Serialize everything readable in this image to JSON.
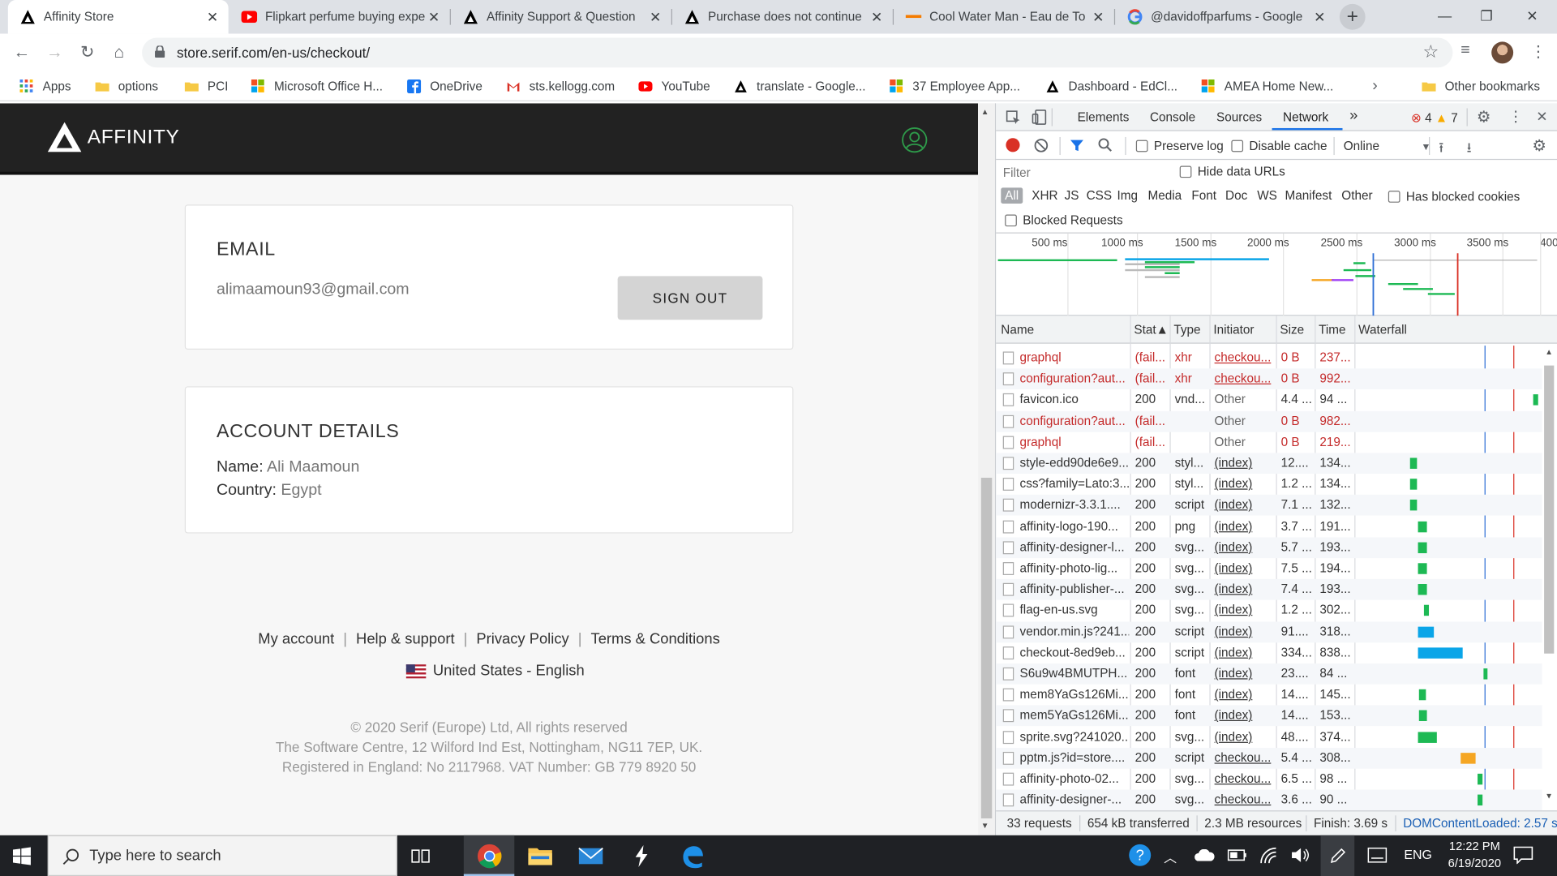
{
  "browser": {
    "tabs": [
      {
        "title": "Affinity Store",
        "icon": "affinity-icon",
        "active": true
      },
      {
        "title": "Flipkart perfume buying expe",
        "icon": "youtube-icon",
        "active": false
      },
      {
        "title": "Affinity Support & Question",
        "icon": "affinity-icon",
        "active": false
      },
      {
        "title": "Purchase does not continue",
        "icon": "affinity-icon",
        "active": false
      },
      {
        "title": "Cool Water Man - Eau de To",
        "icon": "dash-icon",
        "active": false
      },
      {
        "title": "@davidoffparfums - Google",
        "icon": "google-icon",
        "active": false
      }
    ],
    "url": "store.serif.com/en-us/checkout/",
    "bookmarks": [
      {
        "label": "Apps",
        "icon": "apps-grid-icon"
      },
      {
        "label": "options",
        "icon": "folder-icon"
      },
      {
        "label": "PCI",
        "icon": "folder-icon"
      },
      {
        "label": "Microsoft Office H...",
        "icon": "microsoft-icon"
      },
      {
        "label": "OneDrive",
        "icon": "facebook-icon"
      },
      {
        "label": "sts.kellogg.com",
        "icon": "gmail-icon"
      },
      {
        "label": "YouTube",
        "icon": "youtube-icon"
      },
      {
        "label": "translate - Google...",
        "icon": "affinity-icon"
      },
      {
        "label": "37 Employee App...",
        "icon": "microsoft-icon"
      },
      {
        "label": "Dashboard - EdCl...",
        "icon": "affinity-icon"
      },
      {
        "label": "AMEA Home New...",
        "icon": "microsoft-icon"
      }
    ],
    "other_bookmarks": "Other bookmarks"
  },
  "site": {
    "logo_text": "AFFINITY",
    "email_card": {
      "heading": "EMAIL",
      "email": "alimaamoun93@gmail.com",
      "signout_label": "SIGN OUT"
    },
    "account_card": {
      "heading": "ACCOUNT DETAILS",
      "name_label": "Name:",
      "name_value": "Ali Maamoun",
      "country_label": "Country:",
      "country_value": "Egypt"
    },
    "footer": {
      "links": [
        "My account",
        "Help & support",
        "Privacy Policy",
        "Terms & Conditions"
      ],
      "locale": "United States - English",
      "copyright": "© 2020 Serif (Europe) Ltd, All rights reserved",
      "address": "The Software Centre, 12 Wilford Ind Est, Nottingham, NG11 7EP, UK.",
      "registration": "Registered in England: No 2117968. VAT Number: GB 779 8920 50"
    }
  },
  "devtools": {
    "tabs": [
      "Elements",
      "Console",
      "Sources",
      "Network"
    ],
    "more": "»",
    "errors": "4",
    "warnings": "7",
    "preserve_log": "Preserve log",
    "disable_cache": "Disable cache",
    "throttle": "Online",
    "filter_placeholder": "Filter",
    "hide_data_urls": "Hide data URLs",
    "type_filters": [
      "All",
      "XHR",
      "JS",
      "CSS",
      "Img",
      "Media",
      "Font",
      "Doc",
      "WS",
      "Manifest",
      "Other"
    ],
    "has_blocked_cookies": "Has blocked cookies",
    "blocked_requests": "Blocked Requests",
    "timeline_ticks": [
      "500 ms",
      "1000 ms",
      "1500 ms",
      "2000 ms",
      "2500 ms",
      "3000 ms",
      "3500 ms",
      "400"
    ],
    "columns": [
      "Name",
      "Status",
      "Type",
      "Initiator",
      "Size",
      "Time",
      "Waterfall"
    ],
    "status_col_label": "Stat▲",
    "rows": [
      {
        "name": "graphql",
        "status": "(fail...",
        "type": "xhr",
        "initiator": "checkou...",
        "size": "0 B",
        "time": "237...",
        "fail": true,
        "wf_start": null,
        "wf_width": null,
        "wf_color": ""
      },
      {
        "name": "configuration?aut...",
        "status": "(fail...",
        "type": "xhr",
        "initiator": "checkou...",
        "size": "0 B",
        "time": "992...",
        "fail": true,
        "wf_start": null,
        "wf_width": null,
        "wf_color": ""
      },
      {
        "name": "favicon.ico",
        "status": "200",
        "type": "vnd...",
        "initiator": "Other",
        "size": "4.4 ...",
        "time": "94 ...",
        "fail": false,
        "wf_start": 3560,
        "wf_width": 100,
        "wf_color": "#1db954"
      },
      {
        "name": "configuration?aut...",
        "status": "(fail...",
        "type": "",
        "initiator": "Other",
        "size": "0 B",
        "time": "982...",
        "fail": true,
        "wf_start": null,
        "wf_width": null,
        "wf_color": ""
      },
      {
        "name": "graphql",
        "status": "(fail...",
        "type": "",
        "initiator": "Other",
        "size": "0 B",
        "time": "219...",
        "fail": true,
        "wf_start": null,
        "wf_width": null,
        "wf_color": ""
      },
      {
        "name": "style-edd90de6e9...",
        "status": "200",
        "type": "styl...",
        "initiator": "(index)",
        "size": "12....",
        "time": "134...",
        "fail": false,
        "wf_start": 1100,
        "wf_width": 130,
        "wf_color": "#1db954"
      },
      {
        "name": "css?family=Lato:3...",
        "status": "200",
        "type": "styl...",
        "initiator": "(index)",
        "size": "1.2 ...",
        "time": "134...",
        "fail": false,
        "wf_start": 1100,
        "wf_width": 130,
        "wf_color": "#1db954"
      },
      {
        "name": "modernizr-3.3.1....",
        "status": "200",
        "type": "script",
        "initiator": "(index)",
        "size": "7.1 ...",
        "time": "132...",
        "fail": false,
        "wf_start": 1100,
        "wf_width": 130,
        "wf_color": "#1db954"
      },
      {
        "name": "affinity-logo-190...",
        "status": "200",
        "type": "png",
        "initiator": "(index)",
        "size": "3.7 ...",
        "time": "191...",
        "fail": false,
        "wf_start": 1250,
        "wf_width": 190,
        "wf_color": "#1db954"
      },
      {
        "name": "affinity-designer-l...",
        "status": "200",
        "type": "svg...",
        "initiator": "(index)",
        "size": "5.7 ...",
        "time": "193...",
        "fail": false,
        "wf_start": 1250,
        "wf_width": 190,
        "wf_color": "#1db954"
      },
      {
        "name": "affinity-photo-lig...",
        "status": "200",
        "type": "svg...",
        "initiator": "(index)",
        "size": "7.5 ...",
        "time": "194...",
        "fail": false,
        "wf_start": 1250,
        "wf_width": 190,
        "wf_color": "#1db954"
      },
      {
        "name": "affinity-publisher-...",
        "status": "200",
        "type": "svg...",
        "initiator": "(index)",
        "size": "7.4 ...",
        "time": "193...",
        "fail": false,
        "wf_start": 1250,
        "wf_width": 190,
        "wf_color": "#1db954"
      },
      {
        "name": "flag-en-us.svg",
        "status": "200",
        "type": "svg...",
        "initiator": "(index)",
        "size": "1.2 ...",
        "time": "302...",
        "fail": false,
        "wf_start": 1370,
        "wf_width": 110,
        "wf_color": "#1db954"
      },
      {
        "name": "vendor.min.js?241...",
        "status": "200",
        "type": "script",
        "initiator": "(index)",
        "size": "91....",
        "time": "318...",
        "fail": false,
        "wf_start": 1250,
        "wf_width": 330,
        "wf_color": "#0aa5e8"
      },
      {
        "name": "checkout-8ed9eb...",
        "status": "200",
        "type": "script",
        "initiator": "(index)",
        "size": "334...",
        "time": "838...",
        "fail": false,
        "wf_start": 1250,
        "wf_width": 900,
        "wf_color": "#0aa5e8"
      },
      {
        "name": "S6u9w4BMUTPH...",
        "status": "200",
        "type": "font",
        "initiator": "(index)",
        "size": "23....",
        "time": "84 ...",
        "fail": false,
        "wf_start": 2560,
        "wf_width": 70,
        "wf_color": "#1db954"
      },
      {
        "name": "mem8YaGs126Mi...",
        "status": "200",
        "type": "font",
        "initiator": "(index)",
        "size": "14....",
        "time": "145...",
        "fail": false,
        "wf_start": 1280,
        "wf_width": 140,
        "wf_color": "#1db954"
      },
      {
        "name": "mem5YaGs126Mi...",
        "status": "200",
        "type": "font",
        "initiator": "(index)",
        "size": "14....",
        "time": "153...",
        "fail": false,
        "wf_start": 1280,
        "wf_width": 150,
        "wf_color": "#1db954"
      },
      {
        "name": "sprite.svg?241020...",
        "status": "200",
        "type": "svg...",
        "initiator": "(index)",
        "size": "48....",
        "time": "374...",
        "fail": false,
        "wf_start": 1260,
        "wf_width": 370,
        "wf_color": "#1db954"
      },
      {
        "name": "pptm.js?id=store....",
        "status": "200",
        "type": "script",
        "initiator": "checkou...",
        "size": "5.4 ...",
        "time": "308...",
        "fail": false,
        "wf_start": 2100,
        "wf_width": 300,
        "wf_color": "#f5a623"
      },
      {
        "name": "affinity-photo-02...",
        "status": "200",
        "type": "svg...",
        "initiator": "checkou...",
        "size": "6.5 ...",
        "time": "98 ...",
        "fail": false,
        "wf_start": 2440,
        "wf_width": 100,
        "wf_color": "#1db954"
      },
      {
        "name": "affinity-designer-...",
        "status": "200",
        "type": "svg...",
        "initiator": "checkou...",
        "size": "3.6 ...",
        "time": "90 ...",
        "fail": false,
        "wf_start": 2440,
        "wf_width": 100,
        "wf_color": "#1db954"
      }
    ],
    "summary": {
      "requests": "33 requests",
      "transferred": "654 kB transferred",
      "resources": "2.3 MB resources",
      "finish": "Finish: 3.69 s",
      "dcl": "DOMContentLoaded: 2.57 s"
    }
  },
  "taskbar": {
    "search_placeholder": "Type here to search",
    "language": "ENG",
    "time": "12:22 PM",
    "date": "6/19/2020"
  },
  "colors": {
    "devtools_accent": "#1a73e8",
    "fail_text": "#c42a2a",
    "dcl_blue": "#1a5fb4",
    "site_header": "#222222",
    "user_icon": "#2e9b4a"
  }
}
